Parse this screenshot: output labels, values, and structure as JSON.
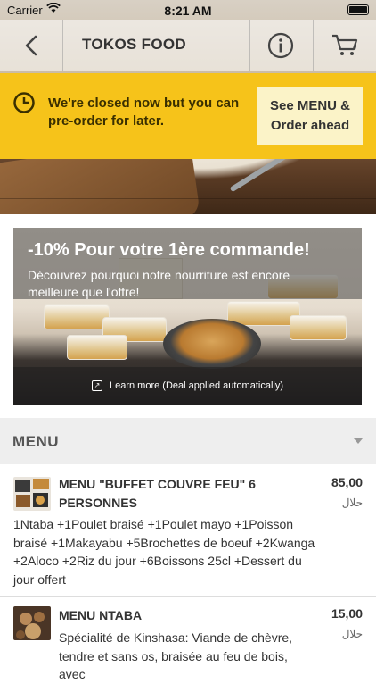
{
  "status_bar": {
    "carrier": "Carrier",
    "time": "8:21 AM"
  },
  "nav": {
    "title": "TOKOS FOOD"
  },
  "closed_banner": {
    "message": "We're closed now but you can pre-order for later.",
    "cta": "See MENU & Order ahead"
  },
  "promo": {
    "headline": "-10% Pour votre 1ère commande!",
    "subtext": "Découvrez pourquoi notre nourriture est encore meilleure que l'offre!",
    "learn_more": "Learn more (Deal applied automatically)"
  },
  "menu": {
    "header": "MENU",
    "items": [
      {
        "name": "MENU \"BUFFET COUVRE FEU\" 6 PERSONNES",
        "price": "85,00",
        "badge": "حلال",
        "description": "1Ntaba +1Poulet braisé +1Poulet mayo +1Poisson braisé +1Makayabu +5Brochettes de boeuf +2Kwanga +2Aloco +2Riz du jour +6Boissons 25cl +Dessert du jour offert"
      },
      {
        "name": "MENU NTABA",
        "price": "15,00",
        "badge": "حلال",
        "description": "Spécialité de Kinshasa: Viande de chèvre, tendre et sans os, braisée au feu de bois, avec"
      }
    ]
  },
  "colors": {
    "banner_yellow": "#f6c31a",
    "cta_bg": "#fbf3c8",
    "menu_header_bg": "#eeeeee"
  },
  "icons": [
    "back-chevron-icon",
    "info-icon",
    "cart-icon",
    "clock-icon",
    "wifi-icon",
    "battery-icon",
    "external-link-icon"
  ]
}
